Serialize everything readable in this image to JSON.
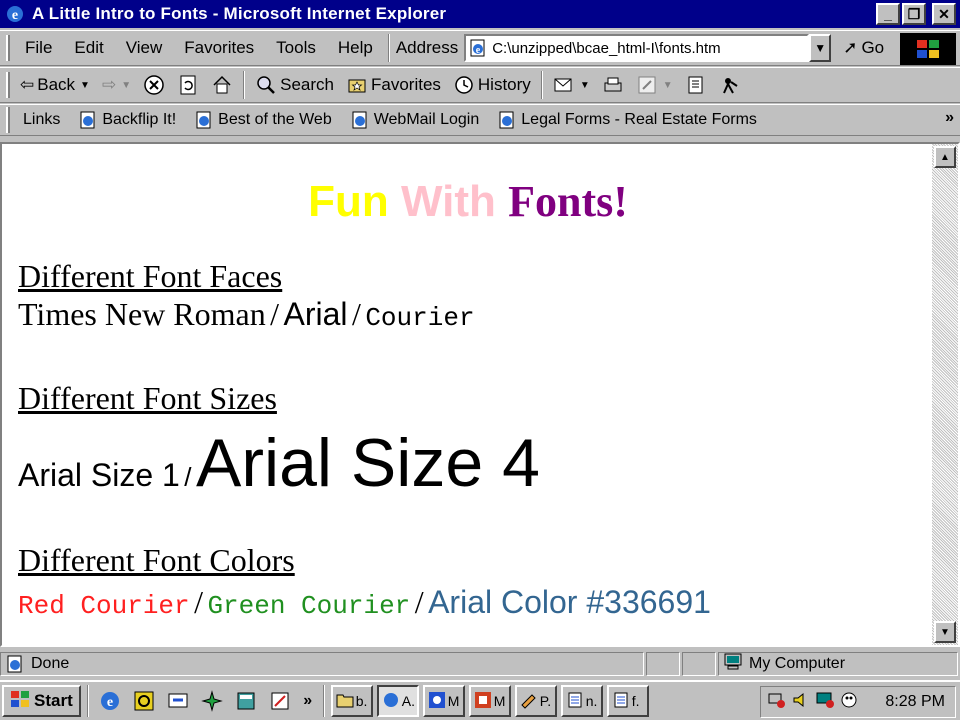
{
  "window": {
    "title": "A Little Intro to Fonts - Microsoft Internet Explorer",
    "minimize": "_",
    "maximize": "❐",
    "close": "✕"
  },
  "menu": [
    "File",
    "Edit",
    "View",
    "Favorites",
    "Tools",
    "Help"
  ],
  "address": {
    "label": "Address",
    "value": "C:\\unzipped\\bcae_html-I\\fonts.htm",
    "go_label": "Go"
  },
  "toolbar": {
    "back": "Back",
    "search": "Search",
    "favorites": "Favorites",
    "history": "History"
  },
  "links": {
    "label": "Links",
    "items": [
      "Backflip It!",
      "Best of the Web",
      "WebMail Login",
      "Legal Forms - Real Estate Forms"
    ]
  },
  "page": {
    "heading": {
      "fun": "Fun",
      "with": "With",
      "fonts": "Fonts!"
    },
    "faces": {
      "title": "Different Font Faces",
      "times": "Times New Roman",
      "arial": "Arial",
      "courier": "Courier",
      "slash": "/"
    },
    "sizes": {
      "title": "Different Font Sizes",
      "size1": "Arial Size 1",
      "size4": "Arial Size 4",
      "slash": "/"
    },
    "colors": {
      "title": "Different Font Colors",
      "red": "Red Courier",
      "green": "Green Courier",
      "blue": "Arial Color #336691",
      "slash": "/"
    }
  },
  "status": {
    "text": "Done",
    "zone": "My Computer"
  },
  "taskbar": {
    "start": "Start",
    "tasks": [
      "b.",
      "A.",
      "M",
      "M",
      "P.",
      "n.",
      "f."
    ],
    "clock": "8:28 PM"
  },
  "colors": {
    "title_bar": "#00008a",
    "fun": "#ffff00",
    "with": "#ffc0cb",
    "fonts": "#800080",
    "red": "#ff2020",
    "green": "#209020",
    "blue": "#336691"
  }
}
